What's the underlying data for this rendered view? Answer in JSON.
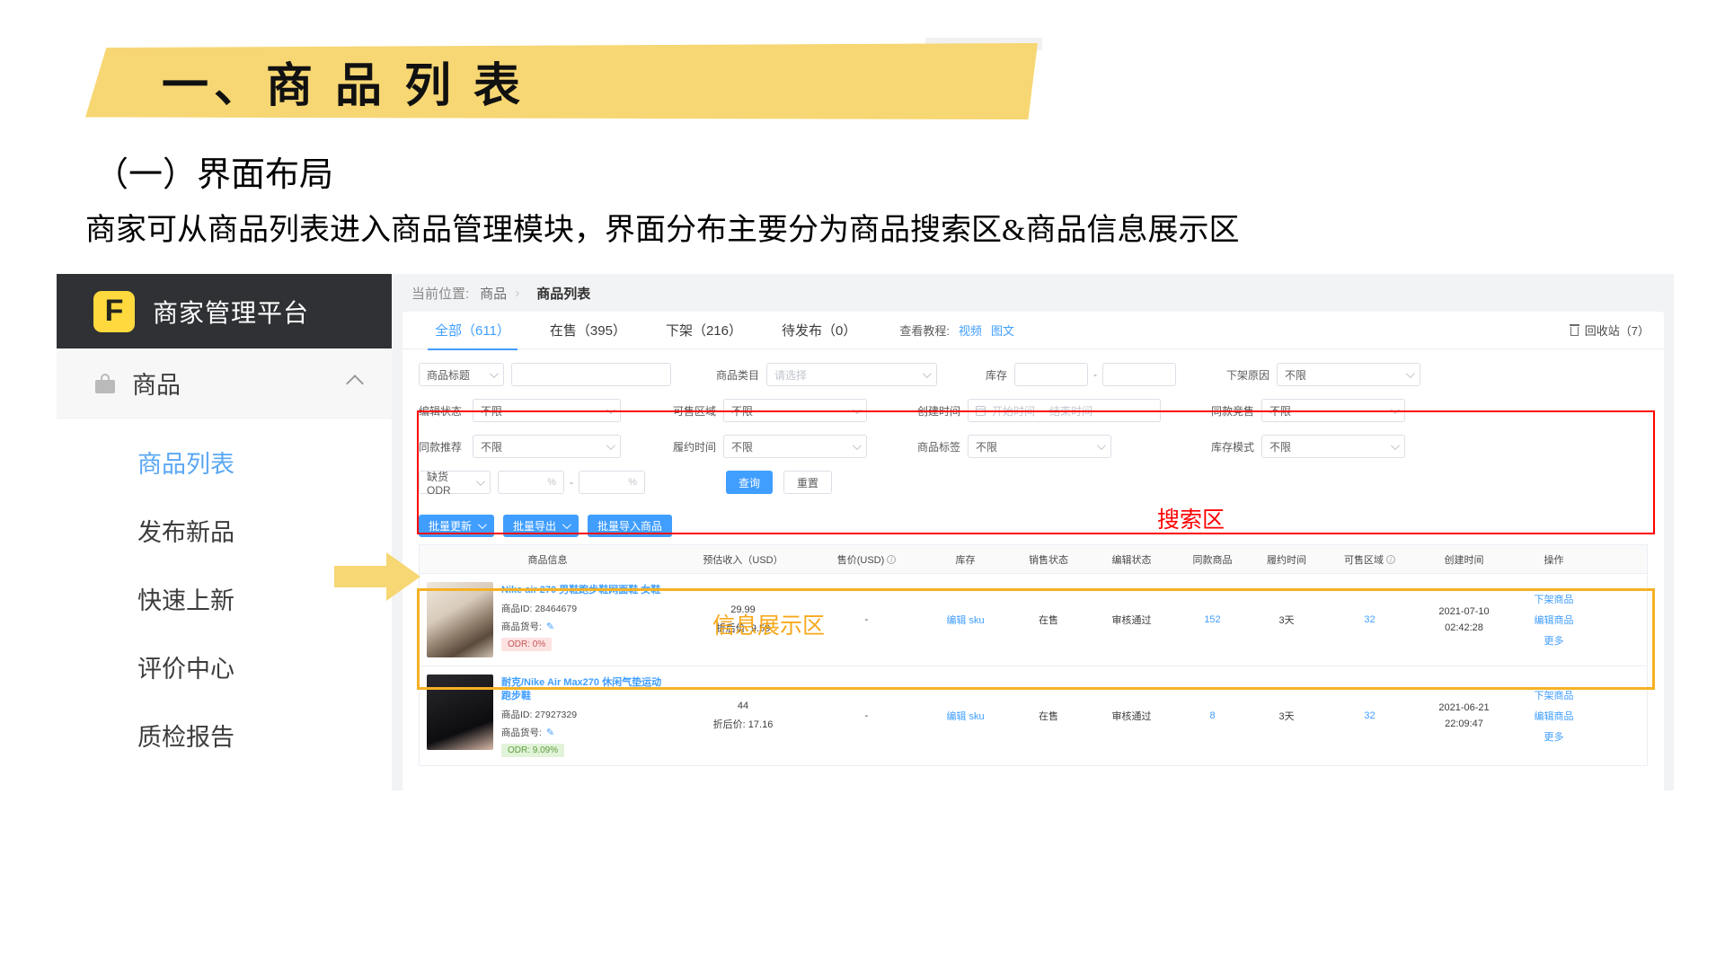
{
  "slide": {
    "title": "一、商 品 列 表",
    "section": "（一）界面布局",
    "description": "商家可从商品列表进入商品管理模块，界面分布主要分为商品搜索区&商品信息展示区",
    "annotations": {
      "search_area": "搜索区",
      "display_area": "信息展示区"
    },
    "colors": {
      "banner": "#f7d774",
      "search_outline": "#ff0000",
      "table_outline": "#f5b125",
      "accent": "#409eff"
    }
  },
  "sidebar": {
    "logo_letter": "F",
    "brand": "商家管理平台",
    "group": {
      "label": "商品",
      "icon": "bag-icon"
    },
    "items": [
      {
        "label": "商品列表",
        "active": true
      },
      {
        "label": "发布新品",
        "active": false
      },
      {
        "label": "快速上新",
        "active": false
      },
      {
        "label": "评价中心",
        "active": false
      },
      {
        "label": "质检报告",
        "active": false
      }
    ]
  },
  "breadcrumb": {
    "prefix": "当前位置:",
    "node": "商品",
    "sep": "›",
    "current": "商品列表"
  },
  "tabs": [
    {
      "label": "全部（611）",
      "active": true
    },
    {
      "label": "在售（395）",
      "active": false
    },
    {
      "label": "下架（216）",
      "active": false
    },
    {
      "label": "待发布（0）",
      "active": false
    }
  ],
  "tutorial": {
    "label": "查看教程:",
    "links": [
      "视频",
      "图文"
    ]
  },
  "recycle_bin": {
    "label": "回收站（7）",
    "icon": "trash-icon"
  },
  "filters": {
    "row1": {
      "title_select": "商品标题",
      "title_input": "",
      "category_label": "商品类目",
      "category_value": "请选择",
      "stock_label": "库存",
      "stock_min": "",
      "stock_max": "",
      "offshelf_label": "下架原因",
      "offshelf_value": "不限"
    },
    "row2": {
      "edit_status_label": "编辑状态",
      "edit_status_value": "不限",
      "region_label": "可售区域",
      "region_value": "不限",
      "created_label": "创建时间",
      "created_start": "开始时间",
      "created_end": "结束时间",
      "compete_label": "同款竞售",
      "compete_value": "不限"
    },
    "row3": {
      "recommend_label": "同款推荐",
      "recommend_value": "不限",
      "fulfil_label": "履约时间",
      "fulfil_value": "不限",
      "tag_label": "商品标签",
      "tag_value": "不限",
      "stockmode_label": "库存模式",
      "stockmode_value": "不限"
    },
    "row4": {
      "odr_select": "缺货ODR",
      "odr_min": "",
      "odr_max": "",
      "unit": "%",
      "dash": "-",
      "query_button": "查询",
      "reset_button": "重置"
    }
  },
  "bulk_actions": [
    {
      "label": "批量更新",
      "caret": true
    },
    {
      "label": "批量导出",
      "caret": true
    },
    {
      "label": "批量导入商品",
      "caret": false
    }
  ],
  "table": {
    "headers": [
      {
        "label": "商品信息",
        "info": false
      },
      {
        "label": "预估收入（USD）",
        "info": false
      },
      {
        "label": "售价(USD)",
        "info": true
      },
      {
        "label": "库存",
        "info": false
      },
      {
        "label": "销售状态",
        "info": false
      },
      {
        "label": "编辑状态",
        "info": false
      },
      {
        "label": "同款商品",
        "info": false
      },
      {
        "label": "履约时间",
        "info": false
      },
      {
        "label": "可售区域",
        "info": true
      },
      {
        "label": "创建时间",
        "info": false
      },
      {
        "label": "操作",
        "info": false
      }
    ],
    "rows": [
      {
        "name": "Nike air 270 男鞋跑步鞋网面鞋 女鞋",
        "id_label": "商品ID:",
        "id_value": "28464679",
        "sku_label": "商品货号:",
        "odr_label": "ODR:",
        "odr_value": "0%",
        "odr_style": "pink",
        "income": "29.99",
        "discount_label": "折后价:",
        "discount_value": "9.59",
        "price": "-",
        "stock": "编辑 sku",
        "sale_status": "在售",
        "edit_status": "审核通过",
        "same_product": "152",
        "fulfil_time": "3天",
        "region": "32",
        "created_date": "2021-07-10",
        "created_time": "02:42:28",
        "ops": [
          "下架商品",
          "编辑商品",
          "更多"
        ]
      },
      {
        "name": "耐克/Nike Air Max270 休闲气垫运动跑步鞋",
        "id_label": "商品ID:",
        "id_value": "27927329",
        "sku_label": "商品货号:",
        "odr_label": "ODR:",
        "odr_value": "9.09%",
        "odr_style": "green",
        "income": "44",
        "discount_label": "折后价:",
        "discount_value": "17.16",
        "price": "-",
        "stock": "编辑 sku",
        "sale_status": "在售",
        "edit_status": "审核通过",
        "same_product": "8",
        "fulfil_time": "3天",
        "region": "32",
        "created_date": "2021-06-21",
        "created_time": "22:09:47",
        "ops": [
          "下架商品",
          "编辑商品",
          "更多"
        ]
      }
    ]
  }
}
